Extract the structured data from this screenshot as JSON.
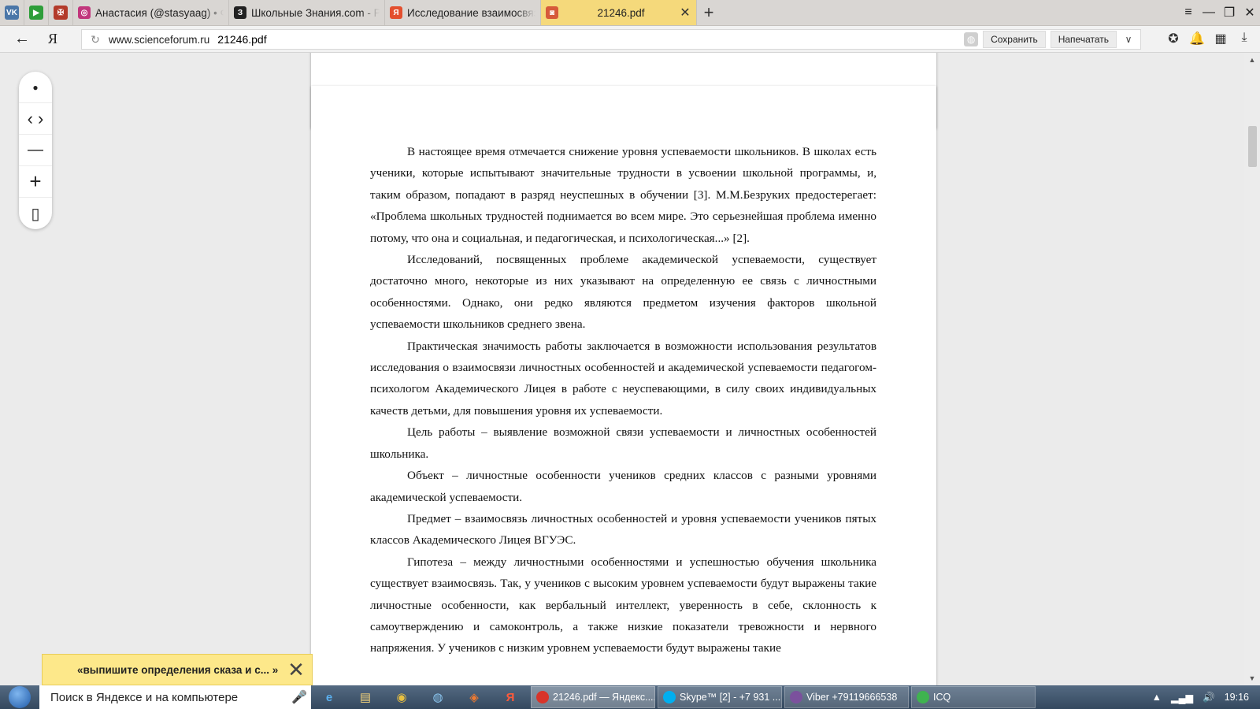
{
  "tabs": {
    "pinned": [
      {
        "name": "vk",
        "label": "VK",
        "color": "#4a76a8"
      },
      {
        "name": "play",
        "label": "▶",
        "color": "#2e9e3a"
      },
      {
        "name": "gosuslugi",
        "label": "✠",
        "color": "#b33a2a"
      }
    ],
    "items": [
      {
        "title": "Анастасия (@stasyaag) • Фо",
        "favicon": "◎",
        "color": "#c1367c"
      },
      {
        "title": "Школьные Знания.com - Ре",
        "favicon": "З",
        "color": "#222222"
      },
      {
        "title": "Исследование взаимосвязи",
        "favicon": "Я",
        "color": "#e34f2e"
      }
    ],
    "active": {
      "title": "21246.pdf",
      "favicon": "◙",
      "color": "#d65a3a"
    },
    "new_tab": "+",
    "window_controls": [
      "≡",
      "—",
      "❐",
      "✕"
    ]
  },
  "address_bar": {
    "back": "←",
    "yandex": "Я",
    "reload": "↻",
    "domain": "www.scienceforum.ru",
    "path": "21246.pdf",
    "save": "Сохранить",
    "print": "Напечатать",
    "dropdown": "∨",
    "tool_icons": [
      "✪",
      "🔔",
      "▦",
      "⤓"
    ]
  },
  "zoom_panel": {
    "dot": "●",
    "nav": "‹ ›",
    "minus": "—",
    "plus": "+",
    "fit": "▯"
  },
  "document": {
    "paragraphs": [
      "В настоящее время отмечается снижение уровня успеваемости школьников. В школах есть ученики, которые испытывают значительные трудности в усвоении школьной программы, и, таким образом, попадают в разряд неуспешных в обучении [3]. М.М.Безруких предостерегает: «Проблема школьных трудностей поднимается во всем мире. Это серьезнейшая проблема именно потому, что она и социальная, и педагогическая, и психологическая...» [2].",
      "Исследований, посвященных проблеме академической успеваемости, существует достаточно много, некоторые из них указывают на определенную ее связь с личностными особенностями. Однако, они редко являются предметом изучения факторов школьной успеваемости школьников среднего звена.",
      "Практическая значимость работы заключается в возможности использования результатов исследования о взаимосвязи личностных особенностей и академической успеваемости педагогом-психологом Академического Лицея в работе с неуспевающими, в силу своих индивидуальных качеств детьми, для повышения уровня их успеваемости.",
      "Цель работы – выявление возможной связи успеваемости и личностных особенностей школьника.",
      " Объект – личностные особенности учеников средних классов с разными уровнями академической успеваемости.",
      "Предмет – взаимосвязь личностных особенностей и уровня успеваемости учеников пятых классов Академического Лицея ВГУЭС.",
      "Гипотеза – между личностными особенностями и успешностью обучения школьника существует взаимосвязь. Так, у учеников с высоким уровнем успеваемости будут выражены такие личностные особенности, как вербальный интеллект, уверенность в себе, склонность к самоутверждению и самоконтроль, а также низкие показатели тревожности и нервного напряжения. У учеников с низким уровнем успеваемости будут выражены такие"
    ]
  },
  "scrollbar": {
    "up": "▲",
    "down": "▼"
  },
  "suggestion": {
    "text": "«выпишите определения сказа и с...  »",
    "close": "✕"
  },
  "taskbar": {
    "search_placeholder": "Поиск в Яндексе и на компьютере",
    "mic": "🎤",
    "quick": [
      "e",
      "▤",
      "◉",
      "◍",
      "◈",
      "Я"
    ],
    "tasks": [
      {
        "label": "21246.pdf — Яндекс....",
        "color": "#d8342a"
      },
      {
        "label": "Skype™ [2] - +7 931 ...",
        "color": "#00aff0"
      },
      {
        "label": "Viber +79119666538",
        "color": "#7b519d"
      },
      {
        "label": "ICQ",
        "color": "#3fb34f"
      }
    ],
    "tray": [
      "▲",
      "▂▄▆",
      "🔊"
    ],
    "time": "19:16"
  }
}
